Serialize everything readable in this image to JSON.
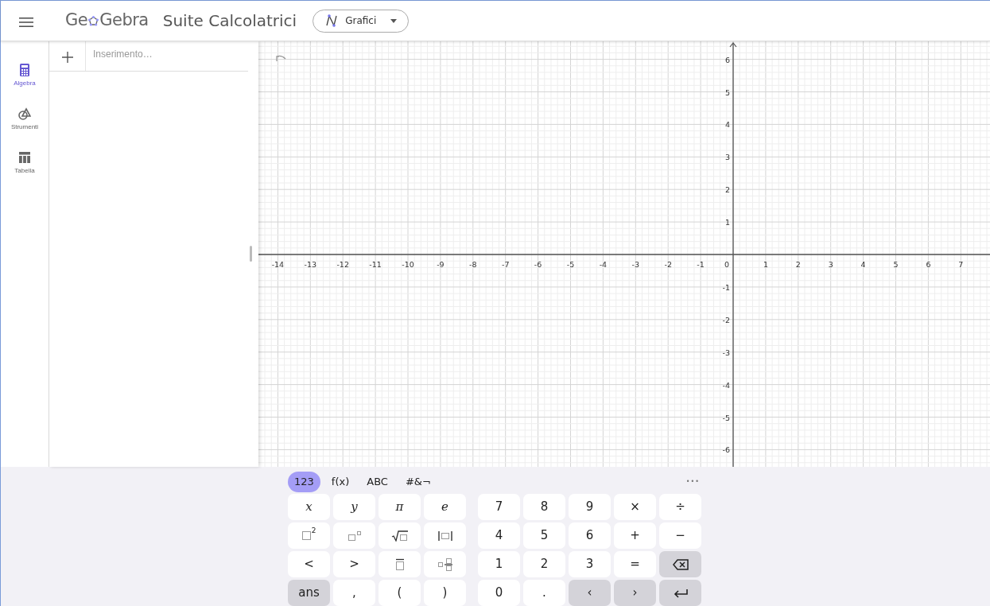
{
  "header": {
    "logo_parts": [
      "Ge",
      "Gebra"
    ],
    "title": "Suite Calcolatrici",
    "app_dropdown": "Grafici"
  },
  "sidebar": {
    "items": [
      {
        "label": "Algebra",
        "kind": "calculator",
        "selected": true
      },
      {
        "label": "Strumenti",
        "kind": "shapes",
        "selected": false
      },
      {
        "label": "Tabella",
        "kind": "table",
        "selected": false
      }
    ]
  },
  "algebra": {
    "input": {
      "placeholder": "Inserimento…"
    }
  },
  "graph": {
    "x_labels": [
      "-14",
      "-13",
      "-12",
      "-11",
      "-10",
      "-9",
      "-8",
      "-7",
      "-6",
      "-5",
      "-4",
      "-3",
      "-2",
      "-1",
      "1",
      "2",
      "3",
      "4",
      "5",
      "6",
      "7"
    ],
    "y_labels": [
      "6",
      "5",
      "4",
      "3",
      "2",
      "1",
      "-1",
      "-2",
      "-3",
      "-4",
      "-5",
      "-6"
    ],
    "origin_label": "0"
  },
  "keyboard": {
    "tabs": [
      {
        "label": "123",
        "selected": true
      },
      {
        "label": "f(x)",
        "selected": false
      },
      {
        "label": "ABC",
        "selected": false
      },
      {
        "label": "#&¬",
        "selected": false
      }
    ],
    "more": "•••",
    "left_rows": [
      [
        {
          "kind": "variable",
          "label": "x",
          "shaded": false
        },
        {
          "kind": "variable",
          "label": "y",
          "shaded": false
        },
        {
          "kind": "variable",
          "label": "π",
          "shaded": false
        },
        {
          "kind": "variable",
          "label": "e",
          "shaded": false
        }
      ],
      [
        {
          "kind": "squared",
          "label": "2",
          "shaded": false
        },
        {
          "kind": "power",
          "shaded": false
        },
        {
          "kind": "root",
          "shaded": false
        },
        {
          "kind": "abs",
          "shaded": false
        }
      ],
      [
        {
          "kind": "text",
          "label": "<",
          "shaded": false
        },
        {
          "kind": "text",
          "label": ">",
          "shaded": false
        },
        {
          "kind": "overline",
          "shaded": false
        },
        {
          "kind": "index",
          "shaded": false
        }
      ],
      [
        {
          "kind": "text",
          "label": "ans",
          "shaded": true
        },
        {
          "kind": "text",
          "label": ",",
          "shaded": false
        },
        {
          "kind": "text",
          "label": "(",
          "shaded": false
        },
        {
          "kind": "text",
          "label": ")",
          "shaded": false
        }
      ]
    ],
    "right_rows": [
      [
        {
          "kind": "text",
          "label": "7",
          "shaded": false
        },
        {
          "kind": "text",
          "label": "8",
          "shaded": false
        },
        {
          "kind": "text",
          "label": "9",
          "shaded": false
        },
        {
          "kind": "text",
          "label": "×",
          "shaded": false
        },
        {
          "kind": "text",
          "label": "÷",
          "shaded": false
        }
      ],
      [
        {
          "kind": "text",
          "label": "4",
          "shaded": false
        },
        {
          "kind": "text",
          "label": "5",
          "shaded": false
        },
        {
          "kind": "text",
          "label": "6",
          "shaded": false
        },
        {
          "kind": "text",
          "label": "+",
          "shaded": false
        },
        {
          "kind": "text",
          "label": "−",
          "shaded": false
        }
      ],
      [
        {
          "kind": "text",
          "label": "1",
          "shaded": false
        },
        {
          "kind": "text",
          "label": "2",
          "shaded": false
        },
        {
          "kind": "text",
          "label": "3",
          "shaded": false
        },
        {
          "kind": "text",
          "label": "=",
          "shaded": false
        },
        {
          "kind": "backspace",
          "shaded": true
        }
      ],
      [
        {
          "kind": "text",
          "label": "0",
          "shaded": false
        },
        {
          "kind": "text",
          "label": ".",
          "shaded": false
        },
        {
          "kind": "text",
          "label": "‹",
          "shaded": true
        },
        {
          "kind": "text",
          "label": "›",
          "shaded": true
        },
        {
          "kind": "enter",
          "shaded": true
        }
      ]
    ]
  }
}
